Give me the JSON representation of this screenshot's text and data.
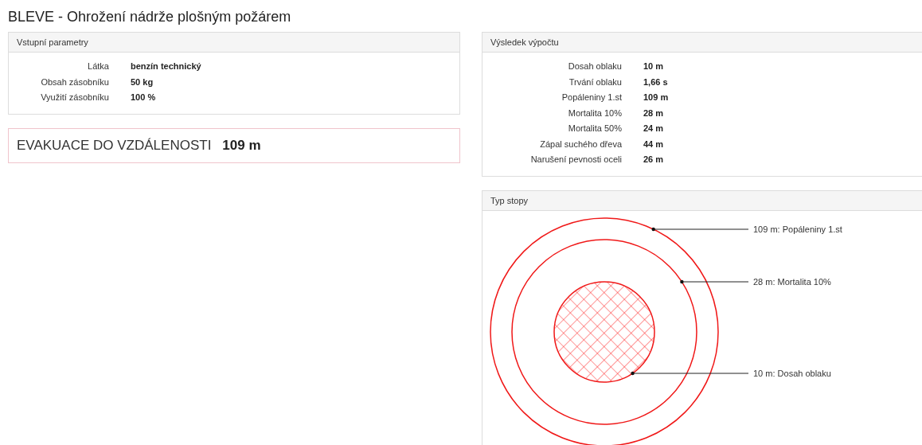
{
  "title": "BLEVE - Ohrožení nádrže plošným požárem",
  "input_panel": {
    "heading": "Vstupní parametry",
    "rows": [
      {
        "label": "Látka",
        "value": "benzín technický"
      },
      {
        "label": "Obsah zásobníku",
        "value": "50 kg"
      },
      {
        "label": "Využití zásobníku",
        "value": "100 %"
      }
    ]
  },
  "evacuation": {
    "label": "EVAKUACE DO VZDÁLENOSTI",
    "value": "109 m"
  },
  "result_panel": {
    "heading": "Výsledek výpočtu",
    "rows": [
      {
        "label": "Dosah oblaku",
        "value": "10 m"
      },
      {
        "label": "Trvání oblaku",
        "value": "1,66 s"
      },
      {
        "label": "Popáleniny 1.st",
        "value": "109 m"
      },
      {
        "label": "Mortalita 10%",
        "value": "28 m"
      },
      {
        "label": "Mortalita 50%",
        "value": "24 m"
      },
      {
        "label": "Zápal suchého dřeva",
        "value": "44 m"
      },
      {
        "label": "Narušení pevnosti oceli",
        "value": "26 m"
      }
    ]
  },
  "footprint_panel": {
    "heading": "Typ stopy",
    "zones": [
      {
        "kind": "outline",
        "label": "109 m: Popáleniny 1.st"
      },
      {
        "kind": "outline",
        "label": "28 m: Mortalita 10%"
      },
      {
        "kind": "hatched",
        "label": "10 m: Dosah oblaku"
      }
    ]
  }
}
